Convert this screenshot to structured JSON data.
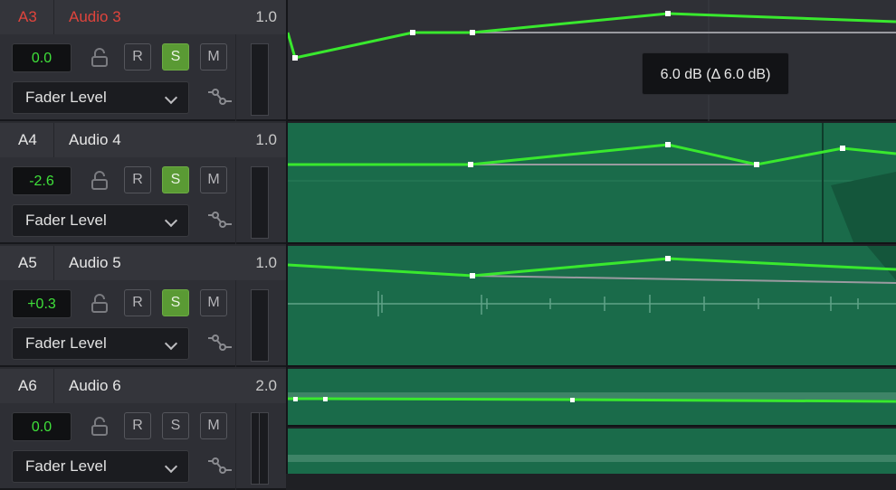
{
  "tracks": [
    {
      "id": "A3",
      "name": "Audio 3",
      "volume": "1.0",
      "level": "0.0",
      "solo": true,
      "selected": true,
      "dropdown": "Fader Level",
      "r_label": "R",
      "s_label": "S",
      "m_label": "M"
    },
    {
      "id": "A4",
      "name": "Audio 4",
      "volume": "1.0",
      "level": "-2.6",
      "solo": true,
      "selected": false,
      "dropdown": "Fader Level",
      "r_label": "R",
      "s_label": "S",
      "m_label": "M"
    },
    {
      "id": "A5",
      "name": "Audio 5",
      "volume": "1.0",
      "level": "+0.3",
      "solo": true,
      "selected": false,
      "dropdown": "Fader Level",
      "r_label": "R",
      "s_label": "S",
      "m_label": "M"
    },
    {
      "id": "A6",
      "name": "Audio 6",
      "volume": "2.0",
      "level": "0.0",
      "solo": false,
      "selected": false,
      "dropdown": "Fader Level",
      "r_label": "R",
      "s_label": "S",
      "m_label": "M"
    }
  ],
  "tooltip": "6.0 dB (Δ 6.0 dB)",
  "colors": {
    "automation_line": "#39e82e",
    "clip_green": "#1a6b4a",
    "selected_track_text": "#e0443c",
    "solo_on": "#5a9a34",
    "level_text": "#3fe03a"
  }
}
